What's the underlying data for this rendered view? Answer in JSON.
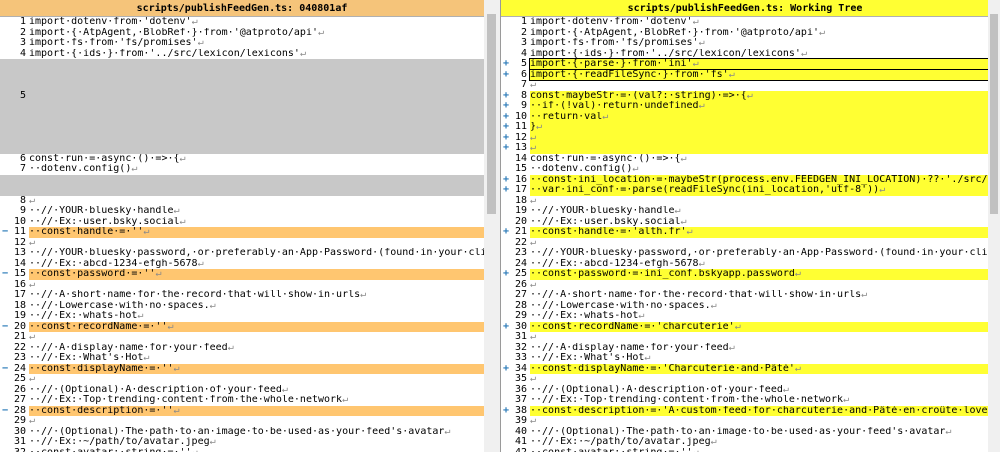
{
  "left": {
    "title": "scripts/publishFeedGen.ts: 040801af"
  },
  "right": {
    "title": "scripts/publishFeedGen.ts: Working Tree"
  },
  "markers": {
    "removed": "−",
    "added": "+"
  },
  "left_rows": [
    {
      "n": "1",
      "t": "import·dotenv·from·'dotenv'"
    },
    {
      "n": "2",
      "t": "import·{·AtpAgent,·BlobRef·}·from·'@atproto/api'"
    },
    {
      "n": "3",
      "t": "import·fs·from·'fs/promises'"
    },
    {
      "n": "4",
      "t": "import·{·ids·}·from·'../src/lexicon/lexicons'"
    },
    {
      "n": "",
      "t": "",
      "k": "gap"
    },
    {
      "n": "",
      "t": "",
      "k": "gap"
    },
    {
      "n": "",
      "t": "",
      "k": "gap"
    },
    {
      "n": "5",
      "t": "",
      "k": "gap"
    },
    {
      "n": "",
      "t": "",
      "k": "gap"
    },
    {
      "n": "",
      "t": "",
      "k": "gap"
    },
    {
      "n": "",
      "t": "",
      "k": "gap"
    },
    {
      "n": "",
      "t": "",
      "k": "gap"
    },
    {
      "n": "",
      "t": "",
      "k": "gap"
    },
    {
      "n": "6",
      "t": "const·run·=·async·()·=>·{"
    },
    {
      "n": "7",
      "t": "··dotenv.config()"
    },
    {
      "n": "",
      "t": "",
      "k": "gap"
    },
    {
      "n": "",
      "t": "",
      "k": "gap"
    },
    {
      "n": "8",
      "t": ""
    },
    {
      "n": "9",
      "t": "··//·YOUR·bluesky·handle"
    },
    {
      "n": "10",
      "t": "··//·Ex:·user.bsky.social"
    },
    {
      "n": "11",
      "t": "··const·handle·=·''",
      "k": "del"
    },
    {
      "n": "12",
      "t": ""
    },
    {
      "n": "13",
      "t": "··//·YOUR·bluesky·password,·or·preferably·an·App·Password·(found·in·your·client·settings)"
    },
    {
      "n": "14",
      "t": "··//·Ex:·abcd-1234-efgh-5678"
    },
    {
      "n": "15",
      "t": "··const·password·=·''",
      "k": "del"
    },
    {
      "n": "16",
      "t": ""
    },
    {
      "n": "17",
      "t": "··//·A·short·name·for·the·record·that·will·show·in·urls"
    },
    {
      "n": "18",
      "t": "··//·Lowercase·with·no·spaces."
    },
    {
      "n": "19",
      "t": "··//·Ex:·whats-hot"
    },
    {
      "n": "20",
      "t": "··const·recordName·=·''",
      "k": "del"
    },
    {
      "n": "21",
      "t": ""
    },
    {
      "n": "22",
      "t": "··//·A·display·name·for·your·feed"
    },
    {
      "n": "23",
      "t": "··//·Ex:·What's·Hot"
    },
    {
      "n": "24",
      "t": "··const·displayName·=·''",
      "k": "del"
    },
    {
      "n": "25",
      "t": ""
    },
    {
      "n": "26",
      "t": "··//·(Optional)·A·description·of·your·feed"
    },
    {
      "n": "27",
      "t": "··//·Ex:·Top·trending·content·from·the·whole·network"
    },
    {
      "n": "28",
      "t": "··const·description·=·''",
      "k": "del"
    },
    {
      "n": "29",
      "t": ""
    },
    {
      "n": "30",
      "t": "··//·(Optional)·The·path·to·an·image·to·be·used·as·your·feed's·avatar"
    },
    {
      "n": "31",
      "t": "··//·Ex:·~/path/to/avatar.jpeg"
    },
    {
      "n": "32",
      "t": "··const·avatar:·string·=·''"
    }
  ],
  "right_rows": [
    {
      "n": "1",
      "t": "import·dotenv·from·'dotenv'"
    },
    {
      "n": "2",
      "t": "import·{·AtpAgent,·BlobRef·}·from·'@atproto/api'"
    },
    {
      "n": "3",
      "t": "import·fs·from·'fs/promises'"
    },
    {
      "n": "4",
      "t": "import·{·ids·}·from·'../src/lexicon/lexicons'"
    },
    {
      "n": "5",
      "t": "import·{·parse·}·from·'ini'",
      "k": "addbox"
    },
    {
      "n": "6",
      "t": "import·{·readFileSync·}·from·'fs'",
      "k": "addbox"
    },
    {
      "n": "7",
      "t": ""
    },
    {
      "n": "8",
      "t": "const·maybeStr·=·(val?:·string)·=>·{",
      "k": "add"
    },
    {
      "n": "9",
      "t": "··if·(!val)·return·undefined",
      "k": "add"
    },
    {
      "n": "10",
      "t": "··return·val",
      "k": "add"
    },
    {
      "n": "11",
      "t": "}",
      "k": "add"
    },
    {
      "n": "12",
      "t": "",
      "k": "add"
    },
    {
      "n": "13",
      "t": "",
      "k": "add"
    },
    {
      "n": "14",
      "t": "const·run·=·async·()·=>·{"
    },
    {
      "n": "15",
      "t": "··dotenv.config()"
    },
    {
      "n": "16",
      "t": "··const·ini_location·=·maybeStr(process.env.FEEDGEN_INI_LOCATION)·??·'./src/conf.ini'",
      "k": "add"
    },
    {
      "n": "17",
      "t": "··var·ini_conf·=·parse(readFileSync(ini_location,'utf-8'))",
      "k": "add"
    },
    {
      "n": "18",
      "t": ""
    },
    {
      "n": "19",
      "t": "··//·YOUR·bluesky·handle"
    },
    {
      "n": "20",
      "t": "··//·Ex:·user.bsky.social"
    },
    {
      "n": "21",
      "t": "··const·handle·=·'alth.fr'",
      "k": "add"
    },
    {
      "n": "22",
      "t": ""
    },
    {
      "n": "23",
      "t": "··//·YOUR·bluesky·password,·or·preferably·an·App·Password·(found·in·your·client·settings)"
    },
    {
      "n": "24",
      "t": "··//·Ex:·abcd-1234-efgh-5678"
    },
    {
      "n": "25",
      "t": "··const·password·=·ini_conf.bskyapp.password",
      "k": "add"
    },
    {
      "n": "26",
      "t": ""
    },
    {
      "n": "27",
      "t": "··//·A·short·name·for·the·record·that·will·show·in·urls"
    },
    {
      "n": "28",
      "t": "··//·Lowercase·with·no·spaces."
    },
    {
      "n": "29",
      "t": "··//·Ex:·whats-hot"
    },
    {
      "n": "30",
      "t": "··const·recordName·=·'charcuterie'",
      "k": "add"
    },
    {
      "n": "31",
      "t": ""
    },
    {
      "n": "32",
      "t": "··//·A·display·name·for·your·feed"
    },
    {
      "n": "33",
      "t": "··//·Ex:·What's·Hot"
    },
    {
      "n": "34",
      "t": "··const·displayName·=·'Charcuterie·and·Pâté'",
      "k": "add"
    },
    {
      "n": "35",
      "t": ""
    },
    {
      "n": "36",
      "t": "··//·(Optional)·A·description·of·your·feed"
    },
    {
      "n": "37",
      "t": "··//·Ex:·Top·trending·content·from·the·whole·network"
    },
    {
      "n": "38",
      "t": "··const·description·=·'A·custom·feed·for·charcuterie·and·Pâté·en·croûte·lovers·by·@alth.fr'",
      "k": "add"
    },
    {
      "n": "39",
      "t": ""
    },
    {
      "n": "40",
      "t": "··//·(Optional)·The·path·to·an·image·to·be·used·as·your·feed's·avatar"
    },
    {
      "n": "41",
      "t": "··//·Ex:·~/path/to/avatar.jpeg"
    },
    {
      "n": "42",
      "t": "··const·avatar:·string·=·''"
    }
  ]
}
